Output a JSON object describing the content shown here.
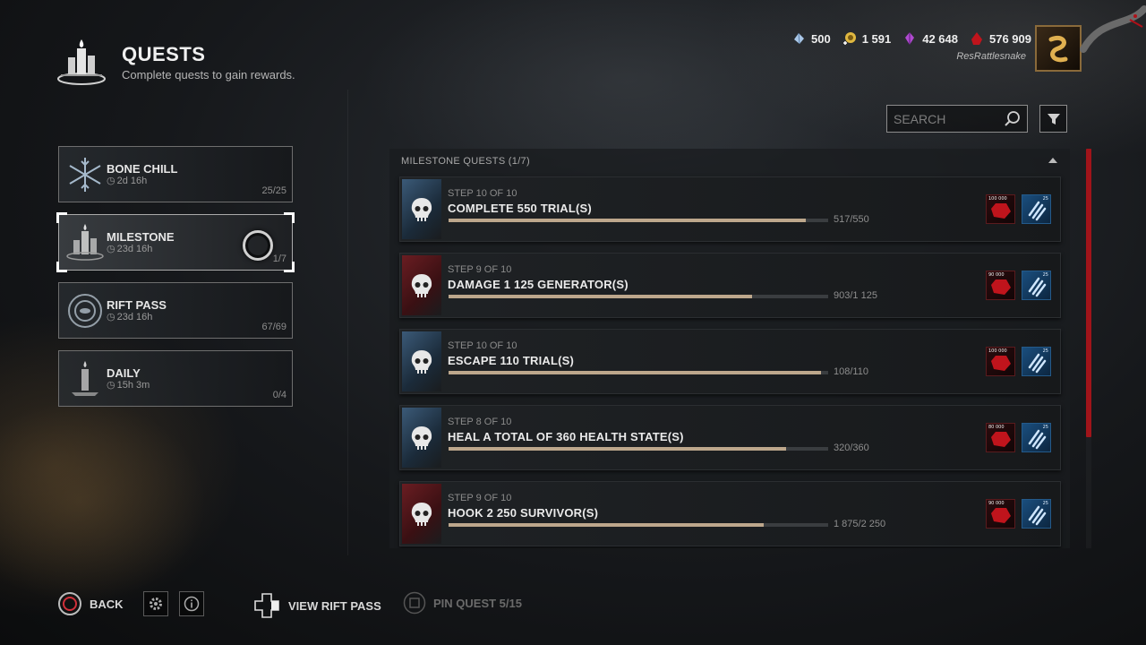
{
  "header": {
    "title": "QUESTS",
    "subtitle": "Complete quests to gain rewards."
  },
  "currencies": [
    {
      "name": "rift-fragments",
      "value": "500",
      "color": "#a9c7e8"
    },
    {
      "name": "auric-cells",
      "value": "1 591",
      "color": "#e0b840"
    },
    {
      "name": "iridescent-shards",
      "value": "42 648",
      "color": "#b04ad0"
    },
    {
      "name": "bloodpoints",
      "value": "576 909",
      "color": "#c0141c"
    }
  ],
  "user": {
    "name": "ResRattlesnake"
  },
  "search": {
    "placeholder": "SEARCH"
  },
  "categories": [
    {
      "name": "BONE CHILL",
      "time": "2d 16h",
      "count": "25/25",
      "icon": "snowflake-icon"
    },
    {
      "name": "MILESTONE",
      "time": "23d 16h",
      "count": "1/7",
      "icon": "candles-icon",
      "selected": true
    },
    {
      "name": "RIFT PASS",
      "time": "23d 16h",
      "count": "67/69",
      "icon": "rift-icon"
    },
    {
      "name": "DAILY",
      "time": "15h 3m",
      "count": "0/4",
      "icon": "candle-icon"
    }
  ],
  "panel": {
    "heading": "MILESTONE QUESTS (1/7)"
  },
  "quests": [
    {
      "step": "STEP 10 OF 10",
      "name": "COMPLETE 550 TRIAL(S)",
      "progress": "517/550",
      "fraction": 0.94,
      "icon_type": "blue",
      "bp_reward": "100 000",
      "rp_reward": "25"
    },
    {
      "step": "STEP 9 OF 10",
      "name": "DAMAGE 1 125 GENERATOR(S)",
      "progress": "903/1 125",
      "fraction": 0.8,
      "icon_type": "red",
      "bp_reward": "90 000",
      "rp_reward": "25"
    },
    {
      "step": "STEP 10 OF 10",
      "name": "ESCAPE 110 TRIAL(S)",
      "progress": "108/110",
      "fraction": 0.98,
      "icon_type": "blue",
      "bp_reward": "100 000",
      "rp_reward": "25"
    },
    {
      "step": "STEP 8 OF 10",
      "name": "HEAL A TOTAL OF 360 HEALTH STATE(S)",
      "progress": "320/360",
      "fraction": 0.89,
      "icon_type": "blue",
      "bp_reward": "80 000",
      "rp_reward": "25"
    },
    {
      "step": "STEP 9 OF 10",
      "name": "HOOK 2 250 SURVIVOR(S)",
      "progress": "1 875/2 250",
      "fraction": 0.83,
      "icon_type": "red",
      "bp_reward": "90 000",
      "rp_reward": "25"
    }
  ],
  "footer": {
    "back_label": "BACK",
    "view_rift_pass_label": "VIEW RIFT PASS",
    "pin_quest_label": "PIN QUEST 5/15"
  }
}
